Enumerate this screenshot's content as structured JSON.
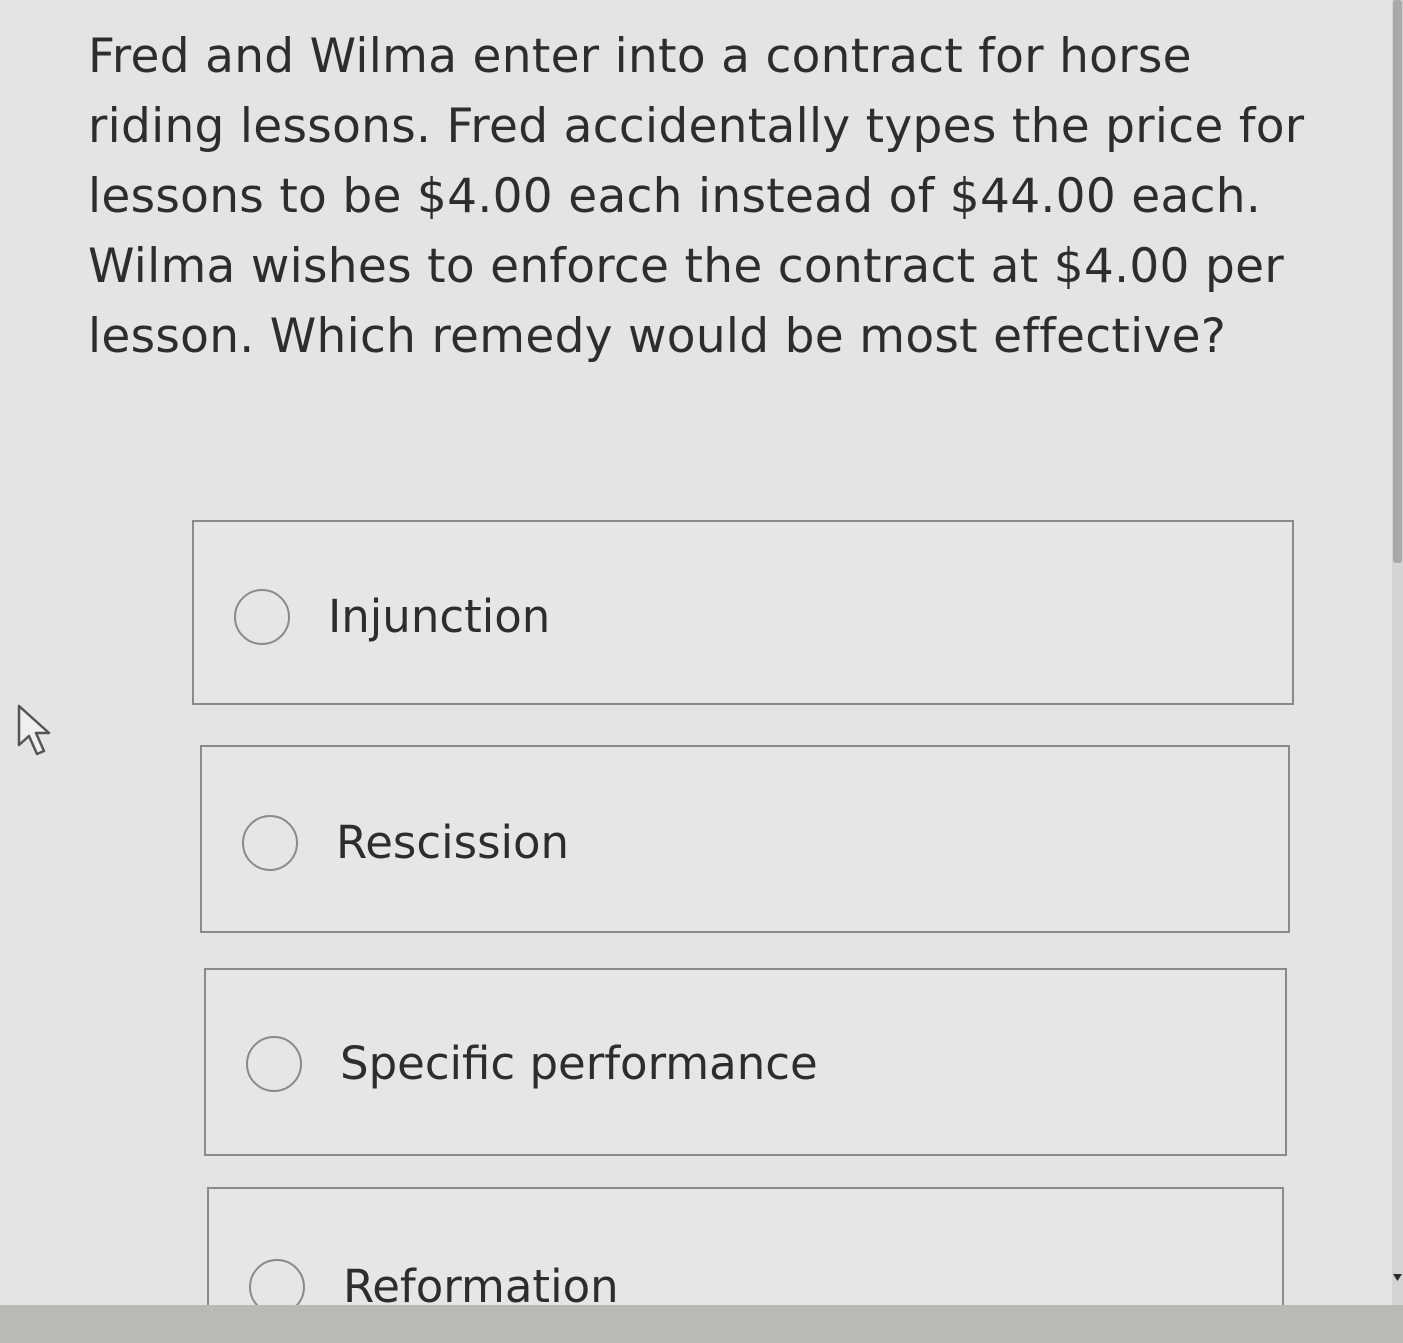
{
  "question": {
    "text": "Fred and Wilma enter into a contract for horse riding lessons. Fred accidentally types the price for lessons to be $4.00 each instead of $44.00 each. Wilma wishes to enforce the contract at $4.00 per lesson. Which remedy would be most effective?"
  },
  "options": [
    {
      "label": "Injunction",
      "selected": false
    },
    {
      "label": "Rescission",
      "selected": false
    },
    {
      "label": "Specific performance",
      "selected": false
    },
    {
      "label": "Reformation",
      "selected": false
    }
  ],
  "icons": {
    "cursor": "mouse-pointer-icon",
    "radio": "radio-button-icon",
    "scroll": "scroll-down-arrow-icon"
  },
  "colors": {
    "background": "#e4e4e2",
    "border": "#8a8a88",
    "text": "#2d2d2d"
  }
}
